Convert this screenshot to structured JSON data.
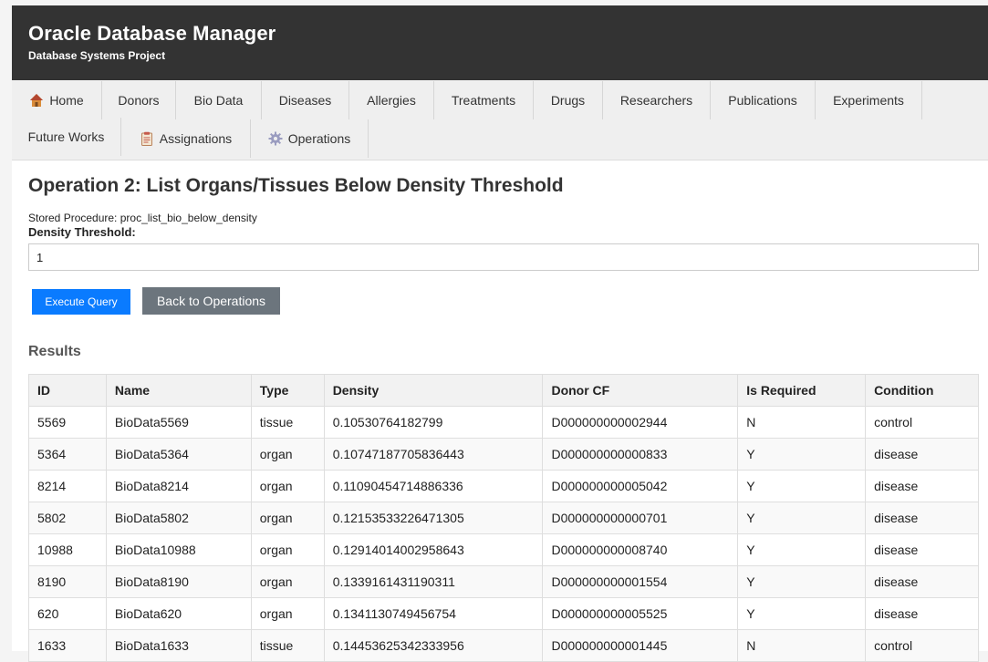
{
  "header": {
    "title": "Oracle Database Manager",
    "subtitle": "Database Systems Project"
  },
  "nav": {
    "items": [
      {
        "label": "Home",
        "icon": "house-icon"
      },
      {
        "label": "Donors"
      },
      {
        "label": "Bio Data"
      },
      {
        "label": "Diseases"
      },
      {
        "label": "Allergies"
      },
      {
        "label": "Treatments"
      },
      {
        "label": "Drugs"
      },
      {
        "label": "Researchers"
      },
      {
        "label": "Publications"
      },
      {
        "label": "Experiments"
      },
      {
        "label": "Future Works"
      },
      {
        "label": "Assignations",
        "icon": "clipboard-icon"
      },
      {
        "label": "Operations",
        "icon": "gear-icon"
      }
    ]
  },
  "operation": {
    "title": "Operation 2: List Organs/Tissues Below Density Threshold",
    "stored_procedure": "Stored Procedure: proc_list_bio_below_density",
    "density_label": "Density Threshold:",
    "density_value": "1",
    "execute_label": "Execute Query",
    "back_label": "Back to Operations"
  },
  "results": {
    "title": "Results",
    "columns": [
      "ID",
      "Name",
      "Type",
      "Density",
      "Donor CF",
      "Is Required",
      "Condition"
    ],
    "rows": [
      [
        "5569",
        "BioData5569",
        "tissue",
        "0.10530764182799",
        "D000000000002944",
        "N",
        "control"
      ],
      [
        "5364",
        "BioData5364",
        "organ",
        "0.10747187705836443",
        "D000000000000833",
        "Y",
        "disease"
      ],
      [
        "8214",
        "BioData8214",
        "organ",
        "0.11090454714886336",
        "D000000000005042",
        "Y",
        "disease"
      ],
      [
        "5802",
        "BioData5802",
        "organ",
        "0.12153533226471305",
        "D000000000000701",
        "Y",
        "disease"
      ],
      [
        "10988",
        "BioData10988",
        "organ",
        "0.12914014002958643",
        "D000000000008740",
        "Y",
        "disease"
      ],
      [
        "8190",
        "BioData8190",
        "organ",
        "0.1339161431190311",
        "D000000000001554",
        "Y",
        "disease"
      ],
      [
        "620",
        "BioData620",
        "organ",
        "0.1341130749456754",
        "D000000000005525",
        "Y",
        "disease"
      ],
      [
        "1633",
        "BioData1633",
        "tissue",
        "0.14453625342333956",
        "D000000000001445",
        "N",
        "control"
      ]
    ]
  },
  "colors": {
    "header_bg": "#333333",
    "execute_btn": "#0a7bff",
    "back_btn": "#6c757d"
  }
}
